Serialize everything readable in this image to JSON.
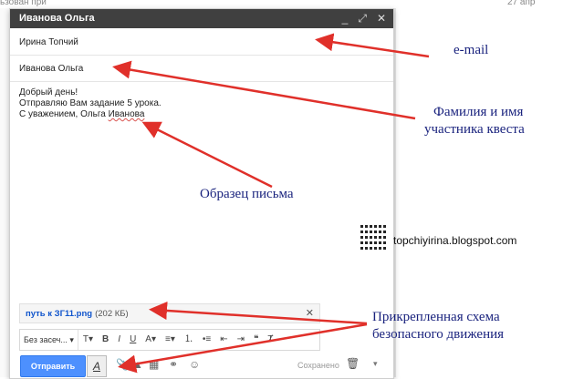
{
  "background": {
    "left_snippet": "ьзован при",
    "right_snippet": "27 апр"
  },
  "compose": {
    "title": "Иванова Ольга",
    "window_icons": [
      "minimize-icon",
      "expand-icon",
      "close-icon"
    ],
    "to": "Ирина Топчий",
    "subject": "Иванова Ольга",
    "body_lines": [
      "Добрый день!",
      "Отправляю Вам задание 5 урока."
    ],
    "body_sign_prefix": "С уважением, Ольга ",
    "body_sign_name": "Иванова",
    "attachment": {
      "name": "путь к ЗГ11.png",
      "size": "(202 КБ)"
    },
    "format_font": "Без засеч...",
    "send_label": "Отправить",
    "saved_label": "Сохранено"
  },
  "annotations": {
    "email": "e-mail",
    "name_line1": "Фамилия и имя",
    "name_line2": "участника квеста",
    "sample": "Образец письма",
    "scheme_line1": "Прикрепленная схема",
    "scheme_line2": "безопасного движения",
    "blog": "topchiyirina.blogspot.com"
  },
  "colors": {
    "titlebar": "#404040",
    "send_button": "#4d90fe",
    "arrow": "#e0302a",
    "annotation_text": "#1a237e"
  }
}
